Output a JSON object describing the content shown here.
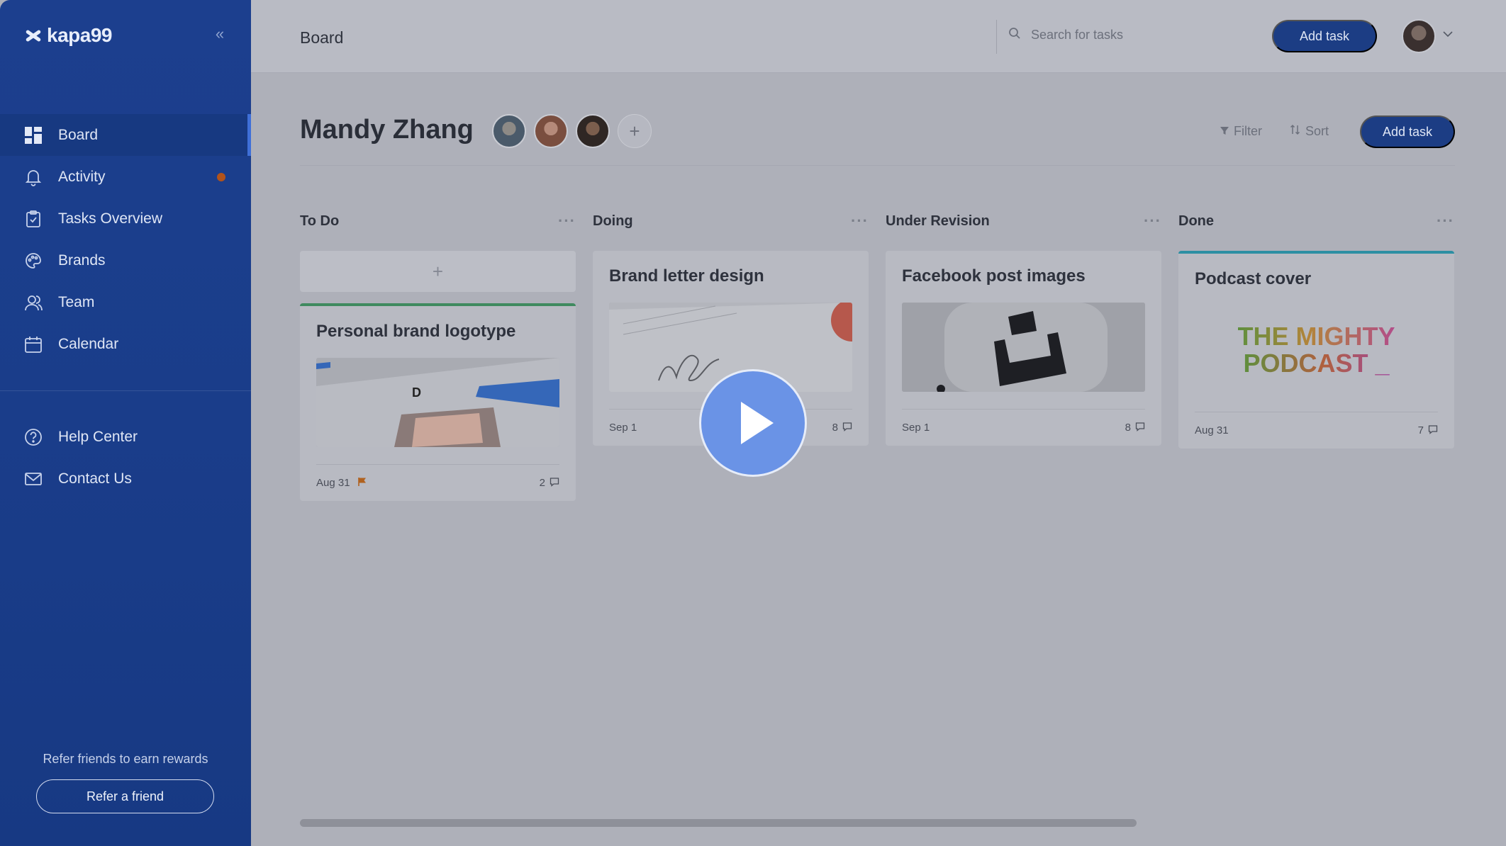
{
  "app": {
    "logo_text": "kapa99"
  },
  "sidebar": {
    "items": [
      {
        "label": "Board",
        "icon": "board-icon",
        "active": true
      },
      {
        "label": "Activity",
        "icon": "bell-icon",
        "has_notification": true
      },
      {
        "label": "Tasks Overview",
        "icon": "clipboard-icon"
      },
      {
        "label": "Brands",
        "icon": "palette-icon"
      },
      {
        "label": "Team",
        "icon": "team-icon"
      },
      {
        "label": "Calendar",
        "icon": "calendar-icon"
      }
    ],
    "secondary": [
      {
        "label": "Help Center",
        "icon": "help-icon"
      },
      {
        "label": "Contact Us",
        "icon": "mail-icon"
      }
    ],
    "refer_text": "Refer friends to earn rewards",
    "refer_button": "Refer a friend"
  },
  "topbar": {
    "title": "Board",
    "search_placeholder": "Search for tasks",
    "add_task": "Add task"
  },
  "board": {
    "owner": "Mandy Zhang",
    "filter_label": "Filter",
    "sort_label": "Sort",
    "add_task": "Add task",
    "columns": [
      {
        "title": "To Do",
        "cards": [
          {
            "title": "Personal brand logotype",
            "date": "Aug 31",
            "flagged": true,
            "comments": "2"
          }
        ]
      },
      {
        "title": "Doing",
        "cards": [
          {
            "title": "Brand letter design",
            "date": "Sep 1",
            "comments": "8"
          }
        ]
      },
      {
        "title": "Under Revision",
        "cards": [
          {
            "title": "Facebook post images",
            "date": "Sep 1",
            "comments": "8"
          }
        ]
      },
      {
        "title": "Done",
        "cards": [
          {
            "title": "Podcast cover",
            "date": "Aug 31",
            "comments": "7",
            "cover_line1": "THE MIGHTY",
            "cover_line2": "PODCAST _"
          }
        ]
      }
    ]
  },
  "colors": {
    "sidebar_bg": "#1c3f8e",
    "accent_button": "#1c3d84",
    "notification_dot": "#b2531a",
    "todo_card_border": "#3f8a5f",
    "done_card_border": "#2d8fa3",
    "play_button": "#6a93e6"
  }
}
